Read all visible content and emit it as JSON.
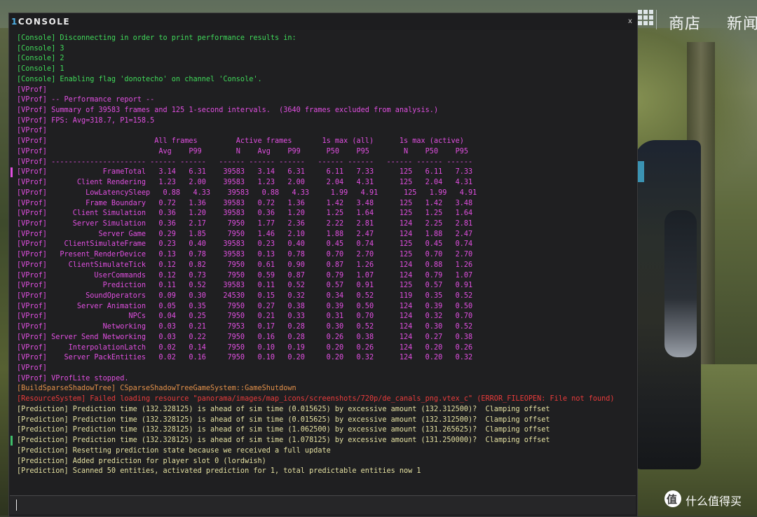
{
  "window": {
    "title_prefix": "1",
    "title": "CONSOLE",
    "close_label": "x"
  },
  "hud": {
    "store_label": "商店",
    "news_label": "新闻"
  },
  "watermark": {
    "icon": "smzdm-logo-icon",
    "text": "什么值得买"
  },
  "colors": {
    "console": "#40d95a",
    "vprof": "#e04fe0",
    "build": "#e3914a",
    "error": "#ea3b3b",
    "prediction": "#e4e0a0",
    "accent": "#4fb0e6"
  },
  "log_lines": [
    {
      "cls": "c-console",
      "text": "[Console] Disconnecting in order to print performance results in:"
    },
    {
      "cls": "c-console",
      "text": "[Console] 3"
    },
    {
      "cls": "c-console",
      "text": "[Console] 2"
    },
    {
      "cls": "c-console",
      "text": "[Console] 1"
    },
    {
      "cls": "c-console",
      "text": "[Console] Enabling flag 'donotecho' on channel 'Console'."
    },
    {
      "cls": "c-vprof",
      "text": "[VProf]"
    },
    {
      "cls": "c-vprof",
      "text": "[VProf] -- Performance report --"
    },
    {
      "cls": "c-vprof",
      "text": "[VProf] Summary of 39583 frames and 125 1-second intervals.  (3640 frames excluded from analysis.)"
    },
    {
      "cls": "c-vprof",
      "text": "[VProf] FPS: Avg=318.7, P1=158.5"
    },
    {
      "cls": "c-vprof",
      "text": "[VProf]"
    },
    {
      "cls": "c-vprof",
      "text": "[VProf]                         All frames         Active frames       1s max (all)      1s max (active)"
    },
    {
      "cls": "c-vprof",
      "text": "[VProf]                          Avg    P99        N    Avg    P99      P50    P95        N    P50    P95"
    },
    {
      "cls": "c-vprof",
      "text": "[VProf] ---------------------- ------ ------   ------ ------ ------   ------ ------   ------ ------ ------"
    },
    {
      "cls": "c-vprof",
      "marker": "#e04fe0",
      "text": "[VProf]             FrameTotal   3.14   6.31    39583   3.14   6.31     6.11   7.33      125   6.11   7.33"
    },
    {
      "cls": "c-vprof",
      "text": "[VProf]       Client Rendering   1.23   2.00    39583   1.23   2.00     2.04   4.31      125   2.04   4.31"
    },
    {
      "cls": "c-vprof",
      "text": "[VProf]         LowLatencySleep   0.88   4.33    39583   0.88   4.33     1.99   4.91      125   1.99   4.91"
    },
    {
      "cls": "c-vprof",
      "text": "[VProf]         Frame Boundary   0.72   1.36    39583   0.72   1.36     1.42   3.48      125   1.42   3.48"
    },
    {
      "cls": "c-vprof",
      "text": "[VProf]      Client Simulation   0.36   1.20    39583   0.36   1.20     1.25   1.64      125   1.25   1.64"
    },
    {
      "cls": "c-vprof",
      "text": "[VProf]      Server Simulation   0.36   2.17     7950   1.77   2.36     2.22   2.81      124   2.25   2.81"
    },
    {
      "cls": "c-vprof",
      "text": "[VProf]            Server Game   0.29   1.85     7950   1.46   2.10     1.88   2.47      124   1.88   2.47"
    },
    {
      "cls": "c-vprof",
      "text": "[VProf]    ClientSimulateFrame   0.23   0.40    39583   0.23   0.40     0.45   0.74      125   0.45   0.74"
    },
    {
      "cls": "c-vprof",
      "text": "[VProf]   Present_RenderDevice   0.13   0.78    39583   0.13   0.78     0.70   2.70      125   0.70   2.70"
    },
    {
      "cls": "c-vprof",
      "text": "[VProf]     ClientSimulateTick   0.12   0.82     7950   0.61   0.90     0.87   1.26      124   0.88   1.26"
    },
    {
      "cls": "c-vprof",
      "text": "[VProf]           UserCommands   0.12   0.73     7950   0.59   0.87     0.79   1.07      124   0.79   1.07"
    },
    {
      "cls": "c-vprof",
      "text": "[VProf]             Prediction   0.11   0.52    39583   0.11   0.52     0.57   0.91      125   0.57   0.91"
    },
    {
      "cls": "c-vprof",
      "text": "[VProf]         SoundOperators   0.09   0.30    24530   0.15   0.32     0.34   0.52      119   0.35   0.52"
    },
    {
      "cls": "c-vprof",
      "text": "[VProf]       Server Animation   0.05   0.35     7950   0.27   0.38     0.39   0.50      124   0.39   0.50"
    },
    {
      "cls": "c-vprof",
      "text": "[VProf]                   NPCs   0.04   0.25     7950   0.21   0.33     0.31   0.70      124   0.32   0.70"
    },
    {
      "cls": "c-vprof",
      "text": "[VProf]             Networking   0.03   0.21     7953   0.17   0.28     0.30   0.52      124   0.30   0.52"
    },
    {
      "cls": "c-vprof",
      "text": "[VProf] Server Send Networking   0.03   0.22     7950   0.16   0.28     0.26   0.38      124   0.27   0.38"
    },
    {
      "cls": "c-vprof",
      "text": "[VProf]     InterpolationLatch   0.02   0.14     7950   0.10   0.19     0.20   0.26      124   0.20   0.26"
    },
    {
      "cls": "c-vprof",
      "text": "[VProf]    Server PackEntities   0.02   0.16     7950   0.10   0.20     0.20   0.32      124   0.20   0.32"
    },
    {
      "cls": "c-vprof",
      "text": "[VProf]"
    },
    {
      "cls": "c-vprof",
      "text": "[VProf] VProfLite stopped."
    },
    {
      "cls": "c-build",
      "text": "[BuildSparseShadowTree] CSparseShadowTreeGameSystem::GameShutdown"
    },
    {
      "cls": "c-error",
      "text": "[ResourceSystem] Failed loading resource \"panorama/images/map_icons/screenshots/720p/de_canals_png.vtex_c\" (ERROR_FILEOPEN: File not found)"
    },
    {
      "cls": "c-pred",
      "text": "[Prediction] Prediction time (132.328125) is ahead of sim time (0.015625) by excessive amount (132.312500)?  Clamping offset"
    },
    {
      "cls": "c-pred",
      "text": "[Prediction] Prediction time (132.328125) is ahead of sim time (0.015625) by excessive amount (132.312500)?  Clamping offset"
    },
    {
      "cls": "c-pred",
      "text": "[Prediction] Prediction time (132.328125) is ahead of sim time (1.062500) by excessive amount (131.265625)?  Clamping offset"
    },
    {
      "cls": "c-pred",
      "marker": "#3fbf6a",
      "text": "[Prediction] Prediction time (132.328125) is ahead of sim time (1.078125) by excessive amount (131.250000)?  Clamping offset"
    },
    {
      "cls": "c-pred",
      "text": "[Prediction] Resetting prediction state because we received a full update"
    },
    {
      "cls": "c-pred",
      "text": "[Prediction] Added prediction for player slot 0 (lordwish)"
    },
    {
      "cls": "c-pred",
      "text": "[Prediction] Scanned 50 entities, activated prediction for 1, total predictable entities now 1"
    }
  ],
  "input": {
    "value": ""
  }
}
